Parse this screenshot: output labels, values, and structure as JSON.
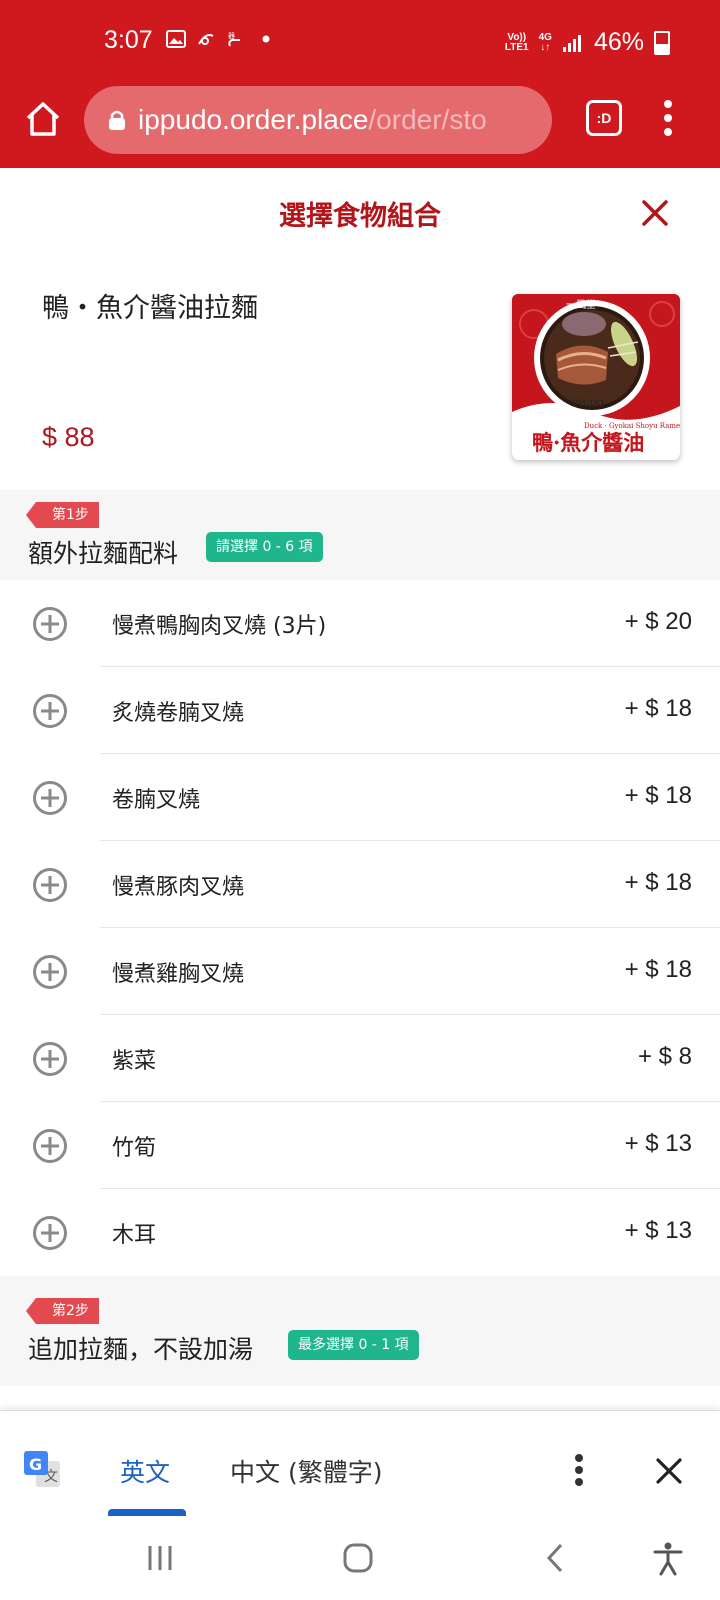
{
  "status_bar": {
    "time": "3:07",
    "network_top": "Vo))",
    "network_bottom": "LTE1",
    "net_type_top": "4G",
    "net_type_bottom": "↓↑",
    "battery": "46%",
    "battery_level": 0.46
  },
  "browser": {
    "url_host": "ippudo.order.place",
    "url_path": "/order/sto",
    "tab_label": ":D"
  },
  "dialog": {
    "title": "選擇食物組合"
  },
  "product": {
    "name": "鴨・魚介醬油拉麵",
    "price": "$ 88",
    "image_caption": "鴨·魚介醬油",
    "image_subcaption": "Duck · Gyokai Shoyu Ramen",
    "image_brand": "IPPUDO"
  },
  "step1": {
    "badge": "第1步",
    "title": "額外拉麵配料",
    "rule": "請選擇 0 - 6 項",
    "options": [
      {
        "label": "慢煮鴨胸肉叉燒 (3片)",
        "price": "+ $ 20"
      },
      {
        "label": "炙燒卷腩叉燒",
        "price": "+ $ 18"
      },
      {
        "label": "卷腩叉燒",
        "price": "+ $ 18"
      },
      {
        "label": "慢煮豚肉叉燒",
        "price": "+ $ 18"
      },
      {
        "label": "慢煮雞胸叉燒",
        "price": "+ $ 18"
      },
      {
        "label": "紫菜",
        "price": "+ $ 8"
      },
      {
        "label": "竹筍",
        "price": "+ $ 13"
      },
      {
        "label": "木耳",
        "price": "+ $ 13"
      }
    ]
  },
  "step2": {
    "badge": "第2步",
    "title": "追加拉麵，不設加湯",
    "rule": "最多選擇 0 - 1 項"
  },
  "translate_bar": {
    "tab_english": "英文",
    "tab_chinese": "中文 (繁體字)"
  },
  "colors": {
    "brand_red": "#d0191f",
    "title_red": "#b1161b",
    "badge_red": "#e24a4f",
    "rule_green": "#1fb68e",
    "translate_blue": "#1b62c6"
  }
}
